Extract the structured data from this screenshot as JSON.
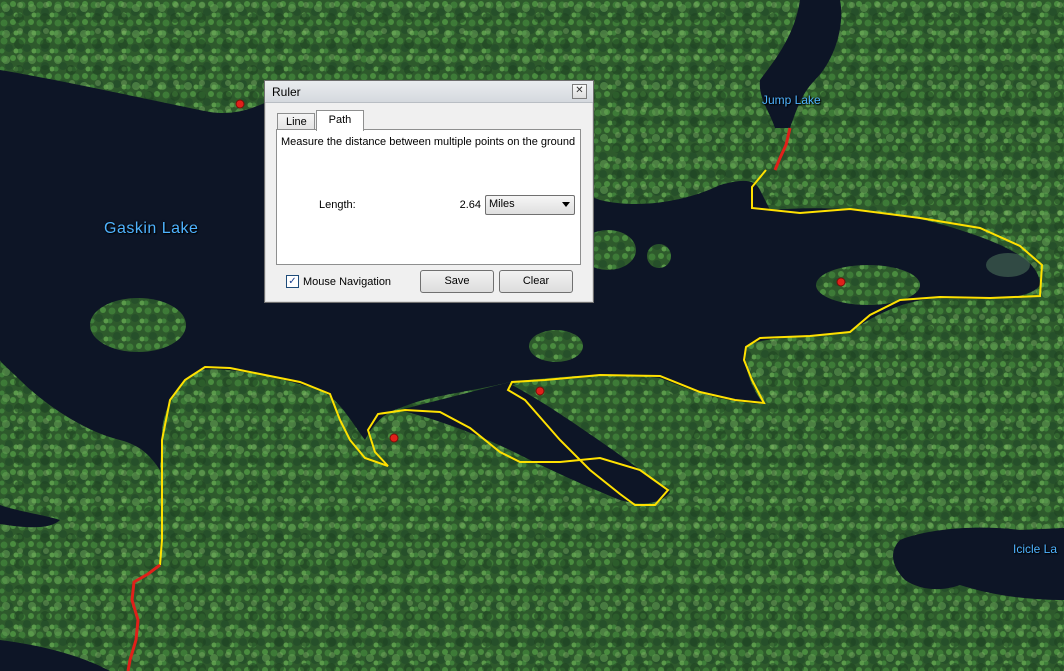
{
  "map": {
    "labels": {
      "gaskin": "Gaskin Lake",
      "jump": "Jump Lake",
      "icicle": "Icicle La"
    },
    "colors": {
      "water": "#0d1526",
      "forest": "#2f5e2e",
      "path": "#ffe100",
      "portage": "#e0201a",
      "label": "#4fb3ff"
    }
  },
  "ruler": {
    "title": "Ruler",
    "close_icon": "close-icon",
    "tabs": [
      {
        "label": "Line",
        "active": false
      },
      {
        "label": "Path",
        "active": true
      }
    ],
    "description": "Measure the distance between multiple points on the ground",
    "length_label": "Length:",
    "length_value": "2.64",
    "units_selected": "Miles",
    "mouse_navigation_label": "Mouse Navigation",
    "mouse_navigation_checked": true,
    "save_label": "Save",
    "clear_label": "Clear"
  }
}
